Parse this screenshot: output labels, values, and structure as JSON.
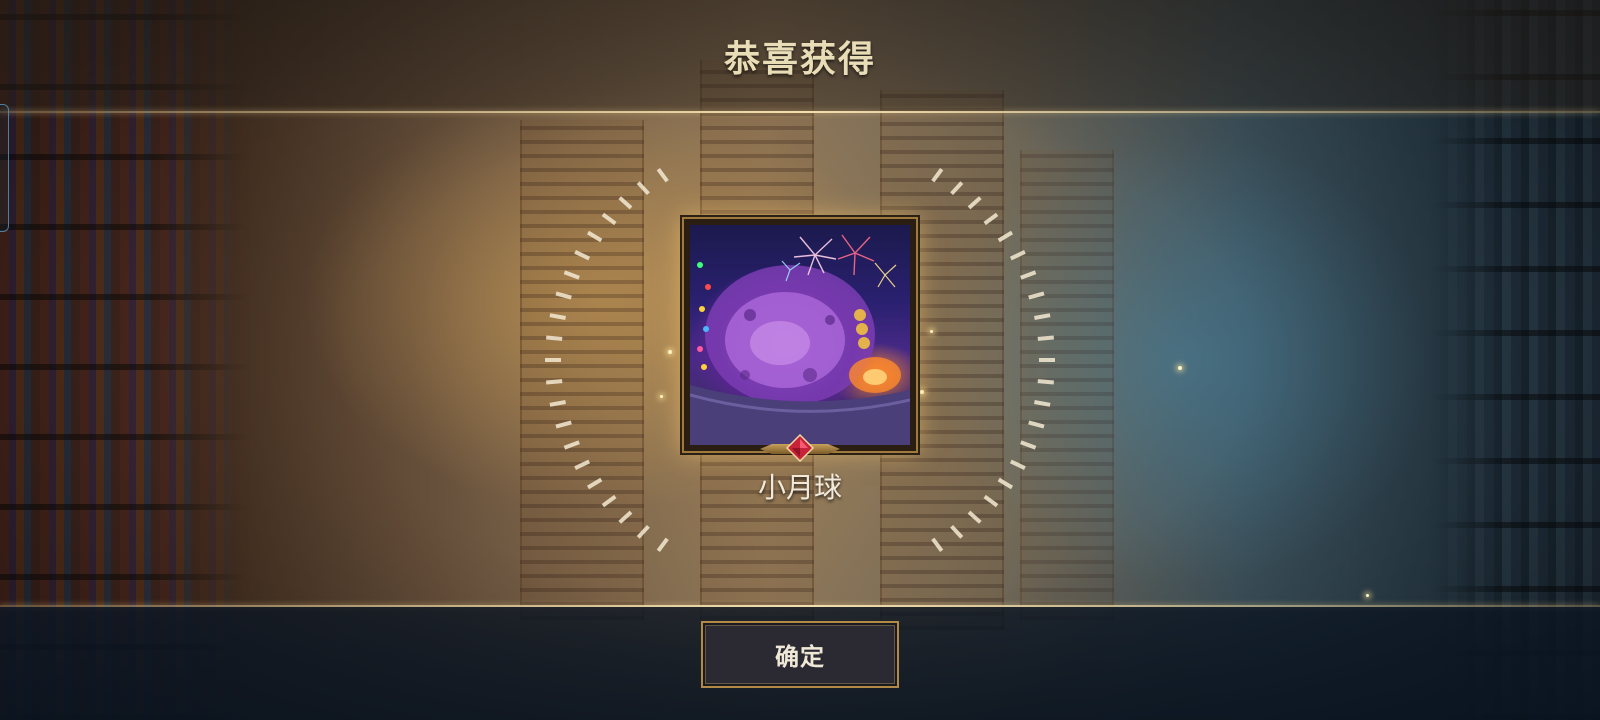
{
  "dialog": {
    "title": "恭喜获得"
  },
  "reward": {
    "name": "小月球",
    "image_icon": "moon-arena-image",
    "rarity_icon": "red-gem-icon"
  },
  "actions": {
    "confirm_label": "确定"
  },
  "colors": {
    "title_text": "#e9ddb8",
    "gold_accent": "#b38a45",
    "button_bg": "#2b2a33",
    "gem_red": "#c8223a"
  }
}
